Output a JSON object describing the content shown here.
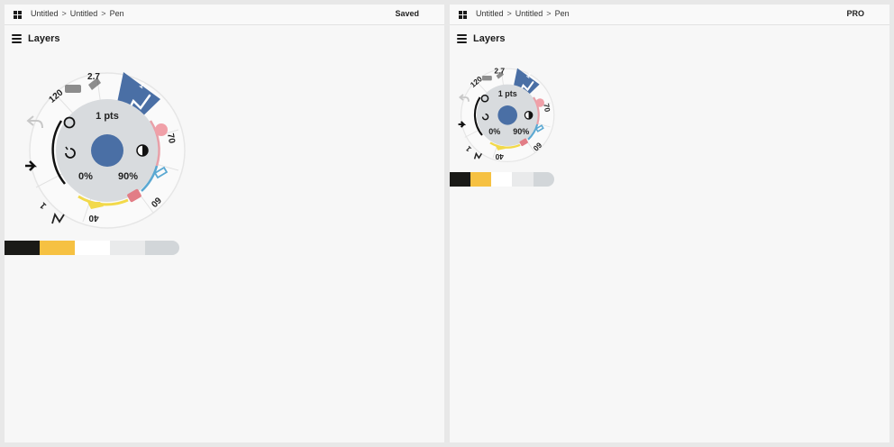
{
  "left_panel": {
    "breadcrumb": [
      "Untitled",
      "Untitled",
      "Pen"
    ],
    "breadcrumb_separator": ">",
    "status": "Saved",
    "layers_label": "Layers",
    "wheel": {
      "size_label": "1 pts",
      "opacity_left": "0%",
      "opacity_right": "90%",
      "ring_labels": {
        "top_left": "120",
        "top": "2.7",
        "right": "70",
        "bottom_right": "60",
        "bottom": "40",
        "tab_v": "1",
        "bottom_left": "1"
      }
    }
  },
  "right_panel": {
    "breadcrumb": [
      "Untitled",
      "Untitled",
      "Pen"
    ],
    "breadcrumb_separator": ">",
    "status": "PRO",
    "layers_label": "Layers",
    "wheel": {
      "size_label": "1 pts",
      "opacity_left": "0%",
      "opacity_right": "90%",
      "ring_labels": {
        "top_left": "120",
        "top": "2.7",
        "right": "70",
        "bottom_right": "60",
        "bottom": "40",
        "tab_v": "1",
        "bottom_left": "1"
      }
    }
  },
  "palette": {
    "colors": [
      "#1a1a17",
      "#f6c142",
      "#ffffff",
      "#e9eaeb",
      "#d2d6d9"
    ]
  },
  "accent": "#4a6fa5",
  "icons": [
    "grid-icon",
    "layers-icon",
    "undo-icon",
    "redo-icon",
    "circle-tool-icon",
    "reset-icon",
    "contrast-icon",
    "pen-icon",
    "pencil-icon",
    "marker-icon",
    "eraser-icon",
    "highlighter-icon",
    "fill-icon",
    "arrow-icon"
  ]
}
